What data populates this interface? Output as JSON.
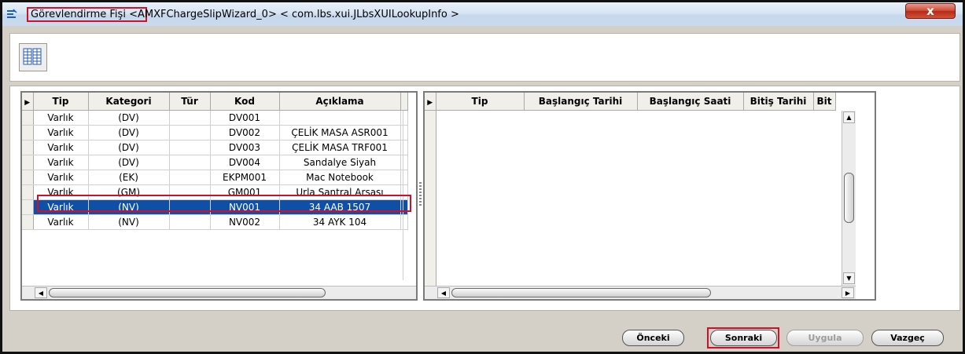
{
  "window": {
    "title_main": "Görevlendirme Fişi",
    "title_rest": " <AMXFChargeSlipWizard_0> < com.lbs.xui.JLbsXUILookupInfo >",
    "close_glyph": "x"
  },
  "left_grid": {
    "header_marker": "▶",
    "columns": [
      "Tip",
      "Kategori",
      "Tür",
      "Kod",
      "Açıklama"
    ],
    "rows": [
      [
        "Varlık",
        "(DV)",
        "",
        "DV001",
        ""
      ],
      [
        "Varlık",
        "(DV)",
        "",
        "DV002",
        "ÇELİK MASA ASR001"
      ],
      [
        "Varlık",
        "(DV)",
        "",
        "DV003",
        "ÇELİK MASA TRF001"
      ],
      [
        "Varlık",
        "(DV)",
        "",
        "DV004",
        "Sandalye Siyah"
      ],
      [
        "Varlık",
        "(EK)",
        "",
        "EKPM001",
        "Mac Notebook"
      ],
      [
        "Varlık",
        "(GM)",
        "",
        "GM001",
        "Urla Santral Arsası"
      ],
      [
        "Varlık",
        "(NV)",
        "",
        "NV001",
        "34 AAB 1507"
      ],
      [
        "Varlık",
        "(NV)",
        "",
        "NV002",
        "34 AYK 104"
      ]
    ],
    "selected_row": 6
  },
  "right_grid": {
    "header_marker": "▶",
    "columns": [
      "Tip",
      "Başlangıç Tarihi",
      "Başlangıç Saati",
      "Bitiş Tarihi",
      "Bit"
    ]
  },
  "scroll": {
    "left_arrow": "◀",
    "right_arrow": "▶",
    "up_arrow": "▲",
    "down_arrow": "▼"
  },
  "buttons": {
    "previous": "Önceki",
    "next": "Sonraki",
    "apply": "Uygula",
    "cancel": "Vazgeç"
  }
}
